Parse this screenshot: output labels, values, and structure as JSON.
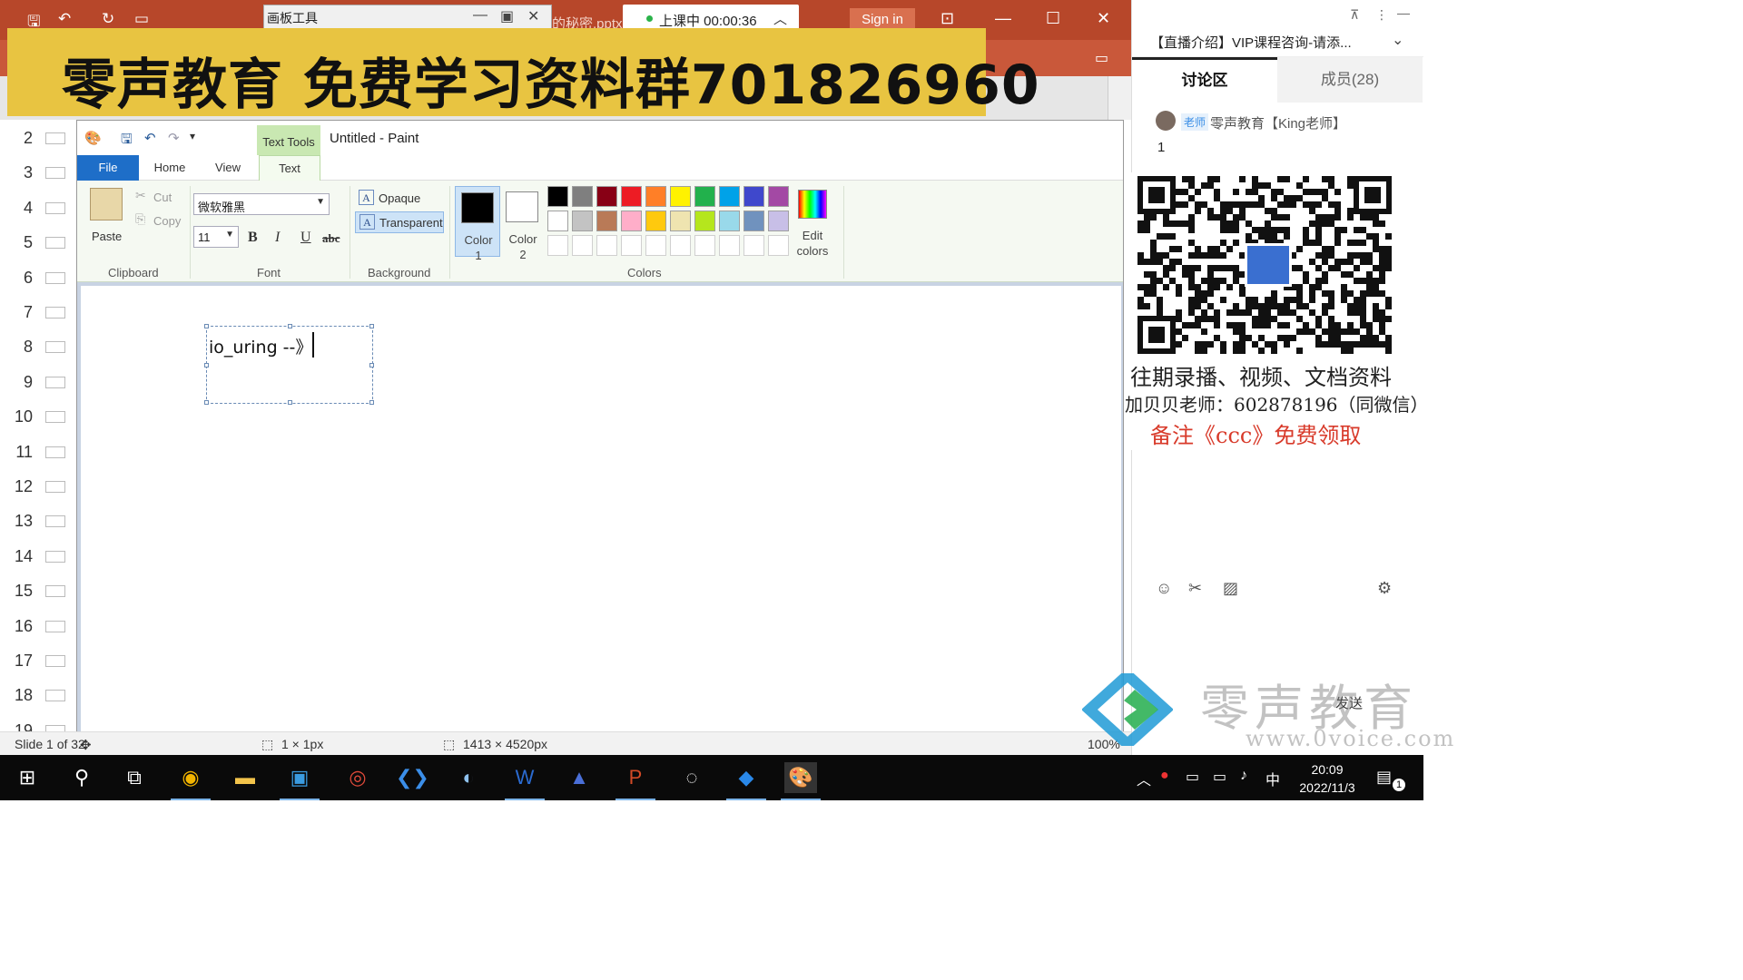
{
  "ppt": {
    "filename_fragment": "的秘密.pptx",
    "sign_in": "Sign in"
  },
  "mini_window": {
    "title": "画板工具"
  },
  "timer": {
    "text": "上课中 00:00:36"
  },
  "banner": {
    "text": "零声教育 免费学习资料群701826960"
  },
  "slides": {
    "numbers": [
      "2",
      "3",
      "4",
      "5",
      "6",
      "7",
      "8",
      "9",
      "10",
      "11",
      "12",
      "13",
      "14",
      "15",
      "16",
      "17",
      "18",
      "19"
    ]
  },
  "paint": {
    "title": "Untitled - Paint",
    "text_tools_badge": "Text Tools",
    "tabs": {
      "file": "File",
      "home": "Home",
      "view": "View",
      "text": "Text"
    },
    "clipboard": {
      "paste": "Paste",
      "cut": "Cut",
      "copy": "Copy",
      "group": "Clipboard"
    },
    "font": {
      "family": "微软雅黑",
      "size": "11",
      "bold": "B",
      "italic": "I",
      "underline": "U",
      "strike": "abc",
      "group": "Font"
    },
    "background": {
      "opaque": "Opaque",
      "transparent": "Transparent",
      "group": "Background",
      "icon_letter": "A"
    },
    "colors": {
      "color1_label_line1": "Color",
      "color1_label_line2": "1",
      "color2_label_line1": "Color",
      "color2_label_line2": "2",
      "color1": "#000000",
      "color2": "#ffffff",
      "edit_line1": "Edit",
      "edit_line2": "colors",
      "group": "Colors",
      "palette_row1": [
        "#000000",
        "#7f7f7f",
        "#880015",
        "#ed1c24",
        "#ff7f27",
        "#fff200",
        "#22b14c",
        "#00a2e8",
        "#3f48cc",
        "#a349a4"
      ],
      "palette_row2": [
        "#ffffff",
        "#c3c3c3",
        "#b97a57",
        "#ffaec9",
        "#ffc90e",
        "#efe4b0",
        "#b5e61d",
        "#99d9ea",
        "#7092be",
        "#c8bfe7"
      ],
      "palette_row3": [
        "#ffffff",
        "#ffffff",
        "#ffffff",
        "#ffffff",
        "#ffffff",
        "#ffffff",
        "#ffffff",
        "#ffffff",
        "#ffffff",
        "#ffffff"
      ]
    },
    "canvas_text": "io_uring --》",
    "status": {
      "slide": "Slide 1 of 32",
      "selection": "1 × 1px",
      "canvas_size": "1413 × 4520px",
      "zoom": "100%"
    }
  },
  "right_panel": {
    "title": "【直播介绍】VIP课程咨询-请添...",
    "tab_discussion": "讨论区",
    "tab_members": "成员(28)",
    "msg_badge": "老师",
    "msg_name": "零声教育【King老师】",
    "msg_text": "1",
    "qr_line1": "往期录播、视频、文档资料",
    "qr_line2": "加贝贝老师：602878196（同微信）",
    "qr_line3": "备注《ccc》免费领取",
    "send": "发送"
  },
  "watermark": {
    "text": "零声教育",
    "url": "www.0voice.com"
  },
  "taskbar": {
    "time": "20:09",
    "date": "2022/11/3",
    "ime": "中",
    "notif_count": "1"
  }
}
